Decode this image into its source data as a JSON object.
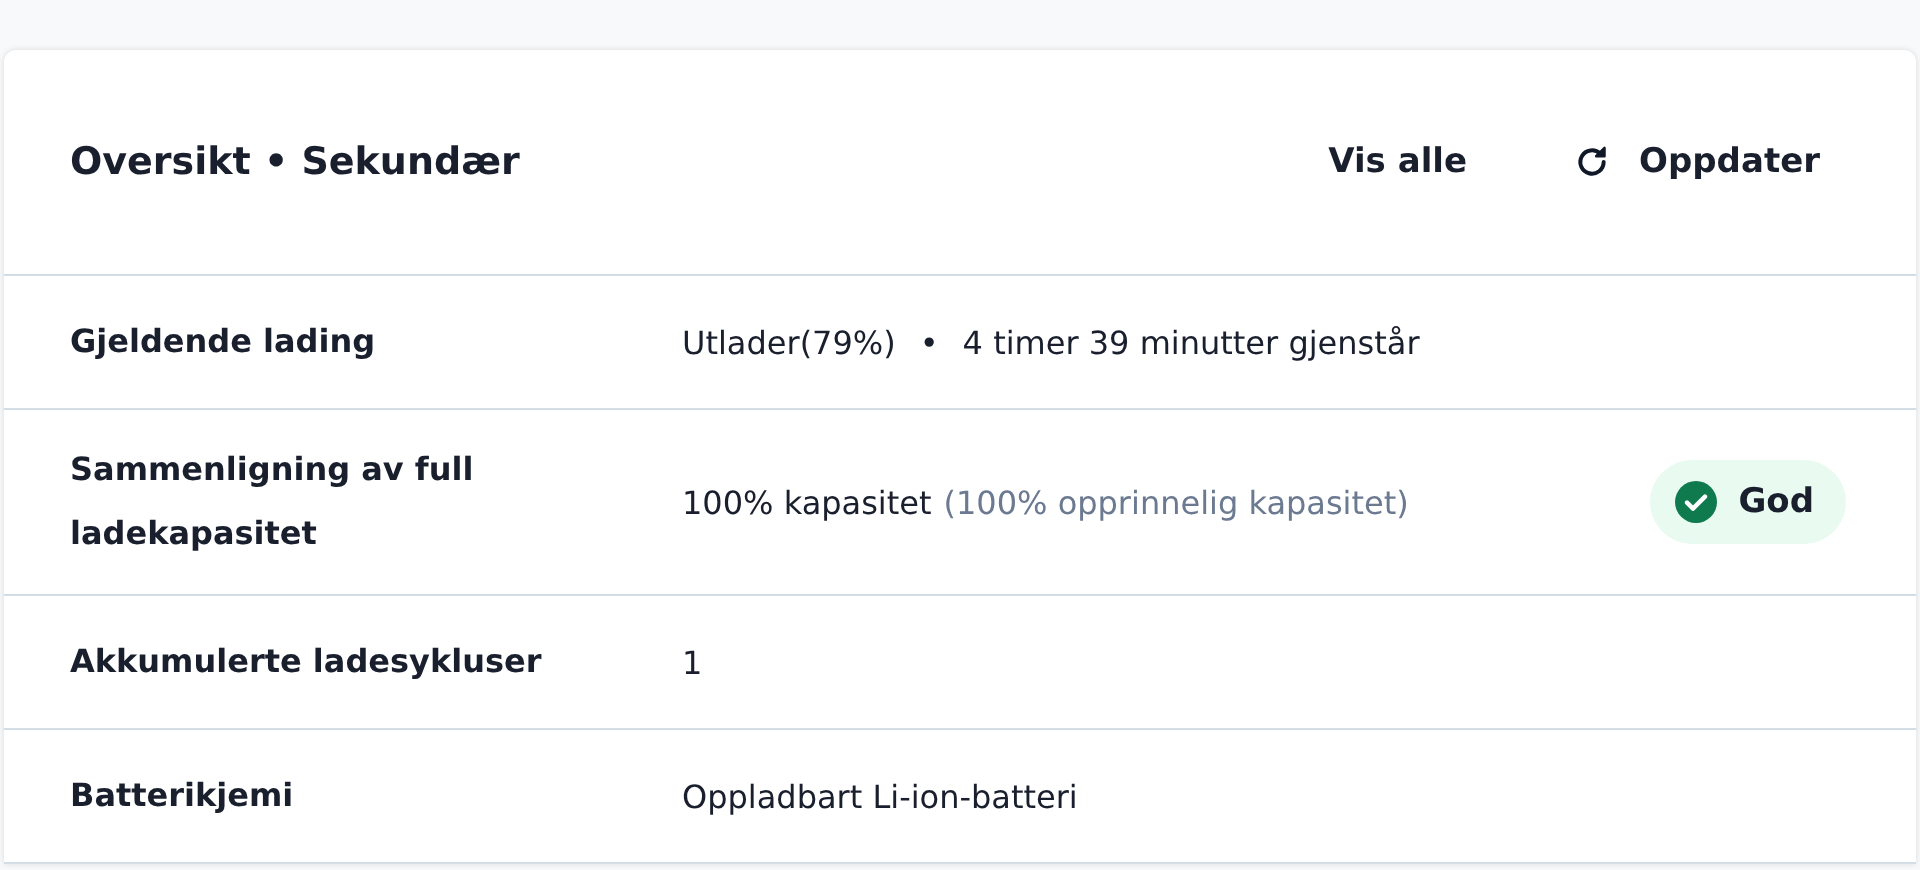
{
  "header": {
    "title": "Oversikt • Sekundær",
    "actions": [
      {
        "label": "Vis alle",
        "kind": "link"
      },
      {
        "label": "Oppdater",
        "kind": "refresh"
      }
    ]
  },
  "rows": [
    {
      "label": "Gjeldende lading",
      "parts": [
        {
          "text": "Utlader(79%)",
          "kind": "text"
        },
        {
          "text": "•",
          "kind": "separator"
        },
        {
          "text": "4 timer 39 minutter gjenstår",
          "kind": "text"
        }
      ]
    },
    {
      "label": "Sammenligning av full ladekapasitet",
      "parts": [
        {
          "text": "100% kapasitet",
          "kind": "text"
        },
        {
          "text": "(100% opprinnelig kapasitet)",
          "kind": "muted"
        }
      ],
      "badge": {
        "label": "God",
        "ok": true
      }
    },
    {
      "label": "Akkumulerte ladesykluser",
      "parts": [
        {
          "text": "1",
          "kind": "text"
        }
      ]
    },
    {
      "label": "Batterikjemi",
      "parts": [
        {
          "text": "Oppladbart Li-ion-batteri",
          "kind": "text"
        }
      ]
    }
  ]
}
